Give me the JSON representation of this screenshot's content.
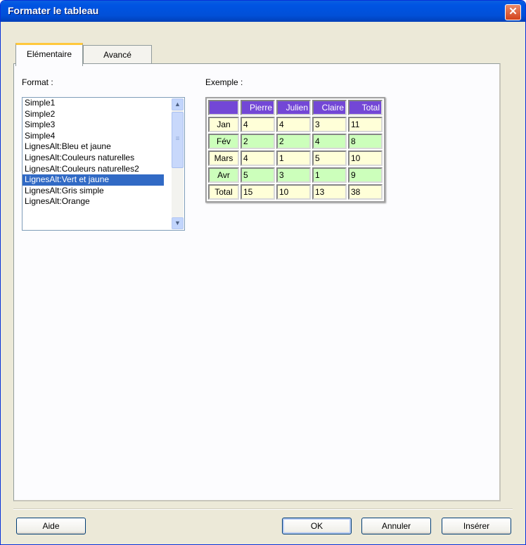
{
  "window": {
    "title": "Formater le tableau",
    "close_icon": "close-icon"
  },
  "tabs": [
    {
      "label": "Elémentaire",
      "active": true
    },
    {
      "label": "Avancé",
      "active": false
    }
  ],
  "format": {
    "label": "Format :",
    "items": [
      "Simple1",
      "Simple2",
      "Simple3",
      "Simple4",
      "LignesAlt:Bleu et jaune",
      "LignesAlt:Couleurs naturelles",
      "LignesAlt:Couleurs naturelles2",
      "LignesAlt:Vert et jaune",
      "LignesAlt:Gris simple",
      "LignesAlt:Orange"
    ],
    "selected": "LignesAlt:Vert et jaune"
  },
  "example": {
    "label": "Exemple :",
    "headers": [
      "",
      "Pierre",
      "Julien",
      "Claire",
      "Total"
    ],
    "rows": [
      [
        "Jan",
        "4",
        "4",
        "3",
        "11"
      ],
      [
        "Fév",
        "2",
        "2",
        "4",
        "8"
      ],
      [
        "Mars",
        "4",
        "1",
        "5",
        "10"
      ],
      [
        "Avr",
        "5",
        "3",
        "1",
        "9"
      ],
      [
        "Total",
        "15",
        "10",
        "13",
        "38"
      ]
    ],
    "colors": {
      "header": "#7347d6",
      "row_yellow": "#ffffd8",
      "row_green": "#ccffbb"
    }
  },
  "buttons": {
    "help": "Aide",
    "ok": "OK",
    "cancel": "Annuler",
    "insert": "Insérer"
  }
}
